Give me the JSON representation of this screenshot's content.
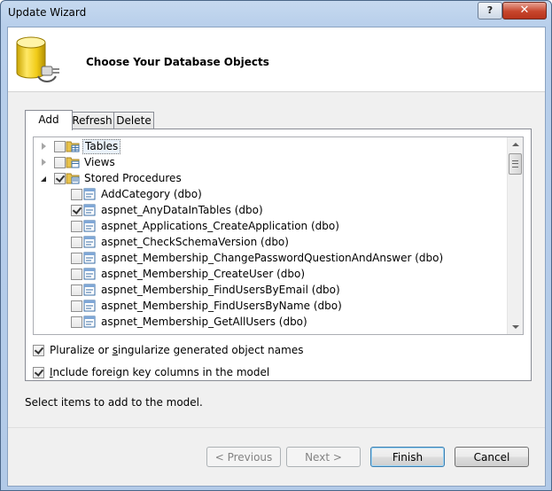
{
  "window": {
    "title": "Update Wizard",
    "help_glyph": "?",
    "close_glyph": "✕"
  },
  "header": {
    "title": "Choose Your Database Objects"
  },
  "tabs": [
    {
      "label": "Add",
      "active": true
    },
    {
      "label": "Refresh",
      "active": false
    },
    {
      "label": "Delete",
      "active": false
    }
  ],
  "tree": {
    "nodes": [
      {
        "label": "Tables",
        "checked": false,
        "expander": "closed",
        "icon": "folder-tables-icon",
        "level": 0,
        "focused": true
      },
      {
        "label": "Views",
        "checked": false,
        "expander": "closed",
        "icon": "folder-views-icon",
        "level": 0
      },
      {
        "label": "Stored Procedures",
        "checked": true,
        "expander": "open",
        "icon": "folder-procedures-icon",
        "level": 0
      },
      {
        "label": "AddCategory (dbo)",
        "checked": false,
        "icon": "stored-procedure-icon",
        "level": 1
      },
      {
        "label": "aspnet_AnyDataInTables (dbo)",
        "checked": true,
        "icon": "stored-procedure-icon",
        "level": 1
      },
      {
        "label": "aspnet_Applications_CreateApplication (dbo)",
        "checked": false,
        "icon": "stored-procedure-icon",
        "level": 1
      },
      {
        "label": "aspnet_CheckSchemaVersion (dbo)",
        "checked": false,
        "icon": "stored-procedure-icon",
        "level": 1
      },
      {
        "label": "aspnet_Membership_ChangePasswordQuestionAndAnswer (dbo)",
        "checked": false,
        "icon": "stored-procedure-icon",
        "level": 1
      },
      {
        "label": "aspnet_Membership_CreateUser (dbo)",
        "checked": false,
        "icon": "stored-procedure-icon",
        "level": 1
      },
      {
        "label": "aspnet_Membership_FindUsersByEmail (dbo)",
        "checked": false,
        "icon": "stored-procedure-icon",
        "level": 1
      },
      {
        "label": "aspnet_Membership_FindUsersByName (dbo)",
        "checked": false,
        "icon": "stored-procedure-icon",
        "level": 1
      },
      {
        "label": "aspnet_Membership_GetAllUsers (dbo)",
        "checked": false,
        "icon": "stored-procedure-icon",
        "level": 1
      }
    ]
  },
  "options": {
    "pluralize": {
      "pre": "Pluralize or ",
      "accel": "s",
      "post": "ingularize generated object names",
      "checked": true
    },
    "foreign_keys": {
      "pre": "",
      "accel": "I",
      "post": "nclude foreign key columns in the model",
      "checked": true
    }
  },
  "status": {
    "text": "Select items to add to the model."
  },
  "buttons": {
    "previous": {
      "label": "< Previous",
      "enabled": false
    },
    "next": {
      "label": "Next >",
      "enabled": false
    },
    "finish": {
      "label": "Finish",
      "enabled": true
    },
    "cancel": {
      "label": "Cancel",
      "enabled": true
    }
  },
  "colors": {
    "title_bar": "#b8cfeb",
    "dialog_bg": "#f0f0f0",
    "close_button": "#c7452c",
    "default_button_border": "#3c7fb1"
  }
}
